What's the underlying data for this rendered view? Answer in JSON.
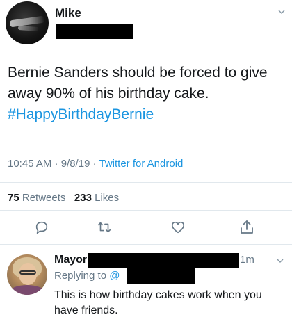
{
  "tweet": {
    "author_name": "Mike",
    "text_main": "Bernie Sanders should be forced to give away 90% of his birthday cake.",
    "hashtag": "#HappyBirthdayBernie",
    "timestamp": "10:45 AM · 9/8/19 · ",
    "client": "Twitter for Android",
    "retweets_count": "75",
    "retweets_label": "Retweets",
    "likes_count": "233",
    "likes_label": "Likes",
    "avatar_icon": "profile-avatar",
    "actions": [
      "reply-icon",
      "retweet-icon",
      "like-icon",
      "share-icon"
    ]
  },
  "reply": {
    "author_name": "Mayor",
    "time": "1m",
    "replying_prefix": "Replying to ",
    "replying_handle": "@",
    "text": "This is how birthday cakes work when you have friends."
  },
  "colors": {
    "text": "#14171a",
    "secondary": "#657786",
    "link": "#1b95e0",
    "divider": "#e1e8ed",
    "redaction": "#000000"
  }
}
